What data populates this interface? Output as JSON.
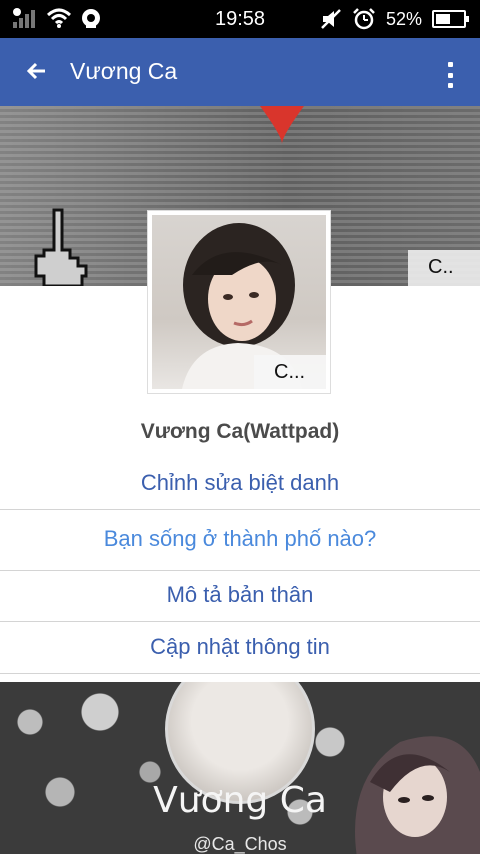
{
  "status_bar": {
    "time": "19:58",
    "battery_percent": "52%",
    "battery_level": 0.52,
    "icons": [
      "signal-icon",
      "wifi-icon",
      "camera-icon",
      "mute-icon",
      "alarm-icon",
      "battery-icon"
    ]
  },
  "app_bar": {
    "title": "Vương Ca",
    "icons": [
      "back-arrow-icon",
      "more-vert-icon"
    ]
  },
  "cover": {
    "badge": "C..",
    "icons": [
      "middle-finger-hand-icon",
      "heart-icon"
    ]
  },
  "avatar": {
    "badge": "C..."
  },
  "profile": {
    "name": "Vương Ca(Wattpad)"
  },
  "actions": {
    "edit_nickname": "Chỉnh sửa biệt danh",
    "city_question": "Bạn sống ở thành phố nào?",
    "describe_self": "Mô tả bản thân",
    "update_info": "Cập nhật thông tin"
  },
  "banner": {
    "title": "Vương Ca",
    "handle": "@Ca_Chos"
  },
  "colors": {
    "app_bar": "#3b5fae",
    "action_dark": "#3b5fae",
    "action_light": "#4a89dc",
    "status_bar": "#000000"
  }
}
